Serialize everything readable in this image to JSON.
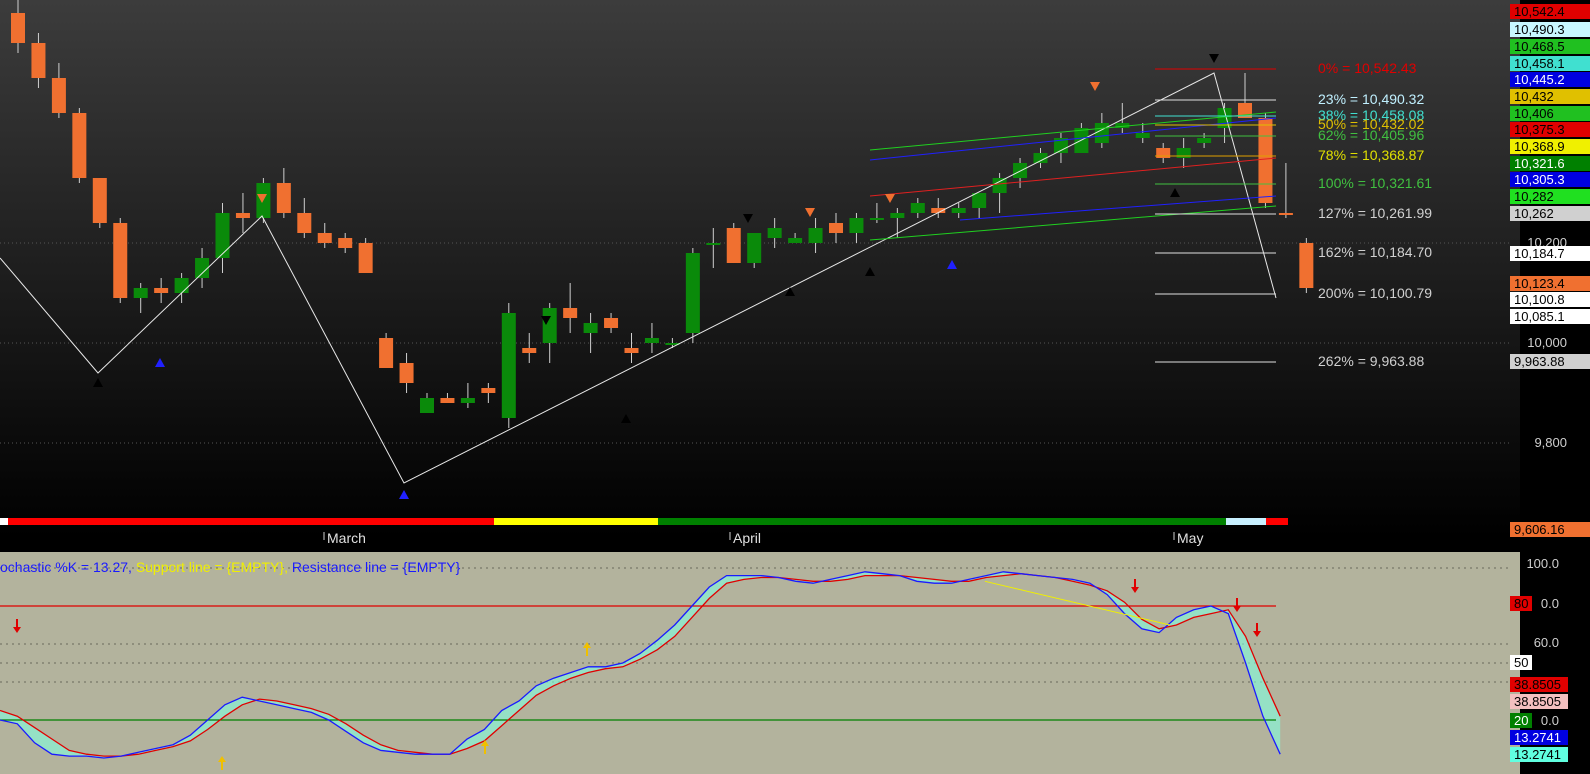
{
  "chart_data": [
    {
      "type": "candlestick",
      "price_axis": {
        "ticks": [
          "10,200",
          "10,000",
          "9,800"
        ]
      },
      "date_labels": [
        "March",
        "April",
        "May"
      ],
      "candles": [
        [
          10660,
          10730,
          10580,
          10600,
          "down"
        ],
        [
          10600,
          10620,
          10510,
          10530,
          "down"
        ],
        [
          10530,
          10560,
          10450,
          10460,
          "down"
        ],
        [
          10460,
          10470,
          10320,
          10330,
          "down"
        ],
        [
          10330,
          10310,
          10230,
          10240,
          "down"
        ],
        [
          10240,
          10250,
          10080,
          10090,
          "down"
        ],
        [
          10090,
          10120,
          10060,
          10110,
          "up"
        ],
        [
          10110,
          10130,
          10080,
          10100,
          "down"
        ],
        [
          10100,
          10140,
          10080,
          10130,
          "up"
        ],
        [
          10130,
          10190,
          10110,
          10170,
          "up"
        ],
        [
          10170,
          10280,
          10140,
          10260,
          "up"
        ],
        [
          10260,
          10300,
          10220,
          10250,
          "down"
        ],
        [
          10250,
          10330,
          10240,
          10320,
          "up"
        ],
        [
          10320,
          10350,
          10250,
          10260,
          "down"
        ],
        [
          10260,
          10290,
          10210,
          10220,
          "down"
        ],
        [
          10220,
          10240,
          10190,
          10200,
          "down"
        ],
        [
          10210,
          10220,
          10180,
          10190,
          "down"
        ],
        [
          10200,
          10210,
          10140,
          10140,
          "down"
        ],
        [
          10010,
          10020,
          9950,
          9950,
          "down"
        ],
        [
          9960,
          9980,
          9900,
          9920,
          "down"
        ],
        [
          9890,
          9900,
          9860,
          9860,
          "up"
        ],
        [
          9890,
          9900,
          9880,
          9880,
          "down"
        ],
        [
          9890,
          9920,
          9870,
          9880,
          "up"
        ],
        [
          9910,
          9920,
          9880,
          9900,
          "down"
        ],
        [
          9850,
          10080,
          9830,
          10060,
          "up"
        ],
        [
          9980,
          10020,
          9960,
          9990,
          "down"
        ],
        [
          10000,
          10080,
          9960,
          10070,
          "up"
        ],
        [
          10070,
          10120,
          10020,
          10050,
          "down"
        ],
        [
          10040,
          10060,
          9980,
          10020,
          "up"
        ],
        [
          10050,
          10060,
          10020,
          10030,
          "down"
        ],
        [
          9990,
          10020,
          9960,
          9980,
          "down"
        ],
        [
          10010,
          10040,
          9980,
          10000,
          "up"
        ],
        [
          10000,
          10010,
          9990,
          10000,
          "up"
        ],
        [
          10020,
          10190,
          10000,
          10180,
          "up"
        ],
        [
          10200,
          10230,
          10150,
          10200,
          "up"
        ],
        [
          10230,
          10240,
          10170,
          10160,
          "down"
        ],
        [
          10160,
          10220,
          10150,
          10220,
          "up"
        ],
        [
          10210,
          10250,
          10190,
          10230,
          "up"
        ],
        [
          10210,
          10220,
          10200,
          10200,
          "up"
        ],
        [
          10200,
          10250,
          10180,
          10230,
          "up"
        ],
        [
          10220,
          10260,
          10200,
          10240,
          "down"
        ],
        [
          10220,
          10260,
          10200,
          10250,
          "up"
        ],
        [
          10250,
          10280,
          10240,
          10250,
          "up"
        ],
        [
          10250,
          10270,
          10210,
          10260,
          "up"
        ],
        [
          10260,
          10290,
          10250,
          10280,
          "up"
        ],
        [
          10270,
          10290,
          10250,
          10260,
          "down"
        ],
        [
          10260,
          10280,
          10250,
          10270,
          "up"
        ],
        [
          10270,
          10290,
          10250,
          10300,
          "up"
        ],
        [
          10300,
          10340,
          10260,
          10330,
          "up"
        ],
        [
          10330,
          10370,
          10310,
          10360,
          "up"
        ],
        [
          10360,
          10390,
          10350,
          10380,
          "up"
        ],
        [
          10380,
          10420,
          10360,
          10410,
          "up"
        ],
        [
          10380,
          10440,
          10380,
          10430,
          "up"
        ],
        [
          10400,
          10460,
          10390,
          10440,
          "up"
        ],
        [
          10440,
          10480,
          10420,
          10430,
          "up"
        ],
        [
          10420,
          10440,
          10400,
          10410,
          "up"
        ],
        [
          10390,
          10400,
          10360,
          10370,
          "down"
        ],
        [
          10370,
          10410,
          10350,
          10390,
          "up"
        ],
        [
          10400,
          10420,
          10390,
          10410,
          "up"
        ],
        [
          10430,
          10480,
          10400,
          10470,
          "up"
        ],
        [
          10480,
          10540,
          10460,
          10450,
          "down"
        ],
        [
          10450,
          10460,
          10270,
          10280,
          "down"
        ],
        [
          10260,
          10360,
          10250,
          10260,
          "down"
        ],
        [
          10200,
          10210,
          10100,
          10110,
          "down"
        ]
      ],
      "markers_note": "signal arrows above/below bars",
      "fib_levels": [
        {
          "label": "0% = 10,542.43",
          "color": "#e00000"
        },
        {
          "label": "23% = 10,490.32",
          "color": "#c0f0ff"
        },
        {
          "label": "38% = 10,458.08",
          "color": "#40e0d0"
        },
        {
          "label": "50% = 10,432.02",
          "color": "#e0c000"
        },
        {
          "label": "62% = 10,405.96",
          "color": "#40c040"
        },
        {
          "label": "78% = 10,368.87",
          "color": "#e0e000"
        },
        {
          "label": "100% = 10,321.61",
          "color": "#40c040"
        },
        {
          "label": "127% = 10,261.99",
          "color": "#d0d0d0"
        },
        {
          "label": "162% = 10,184.70",
          "color": "#d0d0d0"
        },
        {
          "label": "200% = 10,100.79",
          "color": "#d0d0d0"
        },
        {
          "label": "262% = 9,963.88",
          "color": "#d0d0d0"
        }
      ],
      "price_badges": [
        {
          "label": "10,542.4",
          "bg": "#e00000",
          "fg": "#000000"
        },
        {
          "label": "10,490.3",
          "bg": "#c8f8ff",
          "fg": "#000000"
        },
        {
          "label": "10,468.5",
          "bg": "#20c020",
          "fg": "#000000"
        },
        {
          "label": "10,458.1",
          "bg": "#40e0d0",
          "fg": "#000000"
        },
        {
          "label": "10,445.2",
          "bg": "#0000e0",
          "fg": "#ffffff"
        },
        {
          "label": "10,432",
          "bg": "#e0c000",
          "fg": "#000000"
        },
        {
          "label": "10,406",
          "bg": "#20c020",
          "fg": "#000000"
        },
        {
          "label": "10,375.3",
          "bg": "#e00000",
          "fg": "#000000"
        },
        {
          "label": "10,368.9",
          "bg": "#f0f000",
          "fg": "#000000"
        },
        {
          "label": "10,321.6",
          "bg": "#008000",
          "fg": "#ffffff"
        },
        {
          "label": "10,305.3",
          "bg": "#0000e0",
          "fg": "#ffffff"
        },
        {
          "label": "10,282",
          "bg": "#20e020",
          "fg": "#000000"
        },
        {
          "label": "10,262",
          "bg": "#d0d0d0",
          "fg": "#000000"
        },
        {
          "label": "10,184.7",
          "bg": "#ffffff",
          "fg": "#000000"
        },
        {
          "label": "10,123.4",
          "bg": "#f07030",
          "fg": "#000000"
        },
        {
          "label": "10,100.8",
          "bg": "#ffffff",
          "fg": "#000000"
        },
        {
          "label": "10,085.1",
          "bg": "#ffffff",
          "fg": "#000000"
        },
        {
          "label": "9,963.88",
          "bg": "#d0d0d0",
          "fg": "#000000"
        },
        {
          "label": "9,606.16",
          "bg": "#f07030",
          "fg": "#000000"
        }
      ]
    },
    {
      "type": "line",
      "title": {
        "prefix": "ochastic %K = 13.27, ",
        "support": "Support line = {EMPTY}, ",
        "resistance": "Resistance line = {EMPTY}"
      },
      "y_ticks": [
        "100.0",
        "60.0",
        "50",
        "20"
      ],
      "levels": {
        "upper": 80,
        "lower": 20
      },
      "k_values": [
        20,
        18,
        8,
        2,
        1,
        1,
        0,
        1,
        3,
        5,
        7,
        12,
        20,
        28,
        32,
        30,
        28,
        26,
        24,
        20,
        14,
        8,
        4,
        3,
        2,
        2,
        2,
        10,
        15,
        25,
        30,
        38,
        42,
        45,
        48,
        48,
        50,
        55,
        62,
        70,
        80,
        90,
        96,
        96,
        96,
        95,
        93,
        92,
        94,
        96,
        98,
        97,
        96,
        93,
        92,
        92,
        94,
        96,
        98,
        97,
        96,
        95,
        94,
        92,
        86,
        76,
        68,
        66,
        74,
        78,
        80,
        76,
        50,
        22,
        2
      ],
      "d_values": [
        25,
        22,
        16,
        10,
        4,
        2,
        1,
        1,
        2,
        4,
        6,
        9,
        15,
        22,
        28,
        31,
        30,
        28,
        26,
        23,
        18,
        12,
        7,
        4,
        3,
        2,
        2,
        5,
        9,
        17,
        25,
        33,
        38,
        42,
        45,
        47,
        48,
        52,
        57,
        64,
        74,
        84,
        92,
        94,
        95,
        95,
        94,
        93,
        93,
        94,
        96,
        96,
        96,
        95,
        94,
        93,
        93,
        95,
        96,
        97,
        96,
        95,
        93,
        91,
        88,
        82,
        73,
        68,
        70,
        74,
        76,
        78,
        64,
        42,
        22
      ],
      "badges": [
        {
          "label": "80",
          "bg": "#e00000",
          "fg": "#000000"
        },
        {
          "label": "50",
          "bg": "#ffffff",
          "fg": "#000000"
        },
        {
          "label": "38.8505",
          "bg": "#e00000",
          "fg": "#000000"
        },
        {
          "label": "38.8505",
          "bg": "#f4c0c0",
          "fg": "#000000"
        },
        {
          "label": "20",
          "bg": "#008000",
          "fg": "#ffffff"
        },
        {
          "label": "13.2741",
          "bg": "#0000e0",
          "fg": "#ffffff"
        },
        {
          "label": "13.2741",
          "bg": "#60ffe0",
          "fg": "#000000"
        }
      ],
      "badge_ticks": [
        "0.0",
        "0.0"
      ]
    }
  ]
}
